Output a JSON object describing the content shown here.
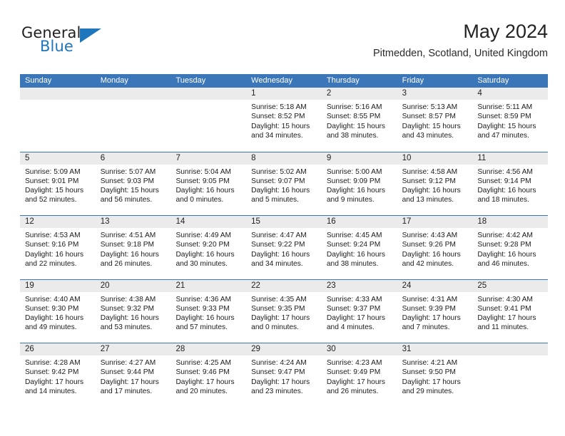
{
  "brand": {
    "name_top": "General",
    "name_bottom": "Blue",
    "color_dark": "#231f20",
    "color_blue": "#1f76bc"
  },
  "header": {
    "title": "May 2024",
    "subtitle": "Pitmedden, Scotland, United Kingdom"
  },
  "theme": {
    "header_blue": "#3a76b8",
    "day_band_gray": "#ebebeb",
    "text": "#1b1b1b"
  },
  "weekdays": [
    "Sunday",
    "Monday",
    "Tuesday",
    "Wednesday",
    "Thursday",
    "Friday",
    "Saturday"
  ],
  "weeks": [
    [
      {
        "day": "",
        "sunrise": "",
        "sunset": "",
        "daylight1": "",
        "daylight2": ""
      },
      {
        "day": "",
        "sunrise": "",
        "sunset": "",
        "daylight1": "",
        "daylight2": ""
      },
      {
        "day": "",
        "sunrise": "",
        "sunset": "",
        "daylight1": "",
        "daylight2": ""
      },
      {
        "day": "1",
        "sunrise": "Sunrise: 5:18 AM",
        "sunset": "Sunset: 8:52 PM",
        "daylight1": "Daylight: 15 hours",
        "daylight2": "and 34 minutes."
      },
      {
        "day": "2",
        "sunrise": "Sunrise: 5:16 AM",
        "sunset": "Sunset: 8:55 PM",
        "daylight1": "Daylight: 15 hours",
        "daylight2": "and 38 minutes."
      },
      {
        "day": "3",
        "sunrise": "Sunrise: 5:13 AM",
        "sunset": "Sunset: 8:57 PM",
        "daylight1": "Daylight: 15 hours",
        "daylight2": "and 43 minutes."
      },
      {
        "day": "4",
        "sunrise": "Sunrise: 5:11 AM",
        "sunset": "Sunset: 8:59 PM",
        "daylight1": "Daylight: 15 hours",
        "daylight2": "and 47 minutes."
      }
    ],
    [
      {
        "day": "5",
        "sunrise": "Sunrise: 5:09 AM",
        "sunset": "Sunset: 9:01 PM",
        "daylight1": "Daylight: 15 hours",
        "daylight2": "and 52 minutes."
      },
      {
        "day": "6",
        "sunrise": "Sunrise: 5:07 AM",
        "sunset": "Sunset: 9:03 PM",
        "daylight1": "Daylight: 15 hours",
        "daylight2": "and 56 minutes."
      },
      {
        "day": "7",
        "sunrise": "Sunrise: 5:04 AM",
        "sunset": "Sunset: 9:05 PM",
        "daylight1": "Daylight: 16 hours",
        "daylight2": "and 0 minutes."
      },
      {
        "day": "8",
        "sunrise": "Sunrise: 5:02 AM",
        "sunset": "Sunset: 9:07 PM",
        "daylight1": "Daylight: 16 hours",
        "daylight2": "and 5 minutes."
      },
      {
        "day": "9",
        "sunrise": "Sunrise: 5:00 AM",
        "sunset": "Sunset: 9:09 PM",
        "daylight1": "Daylight: 16 hours",
        "daylight2": "and 9 minutes."
      },
      {
        "day": "10",
        "sunrise": "Sunrise: 4:58 AM",
        "sunset": "Sunset: 9:12 PM",
        "daylight1": "Daylight: 16 hours",
        "daylight2": "and 13 minutes."
      },
      {
        "day": "11",
        "sunrise": "Sunrise: 4:56 AM",
        "sunset": "Sunset: 9:14 PM",
        "daylight1": "Daylight: 16 hours",
        "daylight2": "and 18 minutes."
      }
    ],
    [
      {
        "day": "12",
        "sunrise": "Sunrise: 4:53 AM",
        "sunset": "Sunset: 9:16 PM",
        "daylight1": "Daylight: 16 hours",
        "daylight2": "and 22 minutes."
      },
      {
        "day": "13",
        "sunrise": "Sunrise: 4:51 AM",
        "sunset": "Sunset: 9:18 PM",
        "daylight1": "Daylight: 16 hours",
        "daylight2": "and 26 minutes."
      },
      {
        "day": "14",
        "sunrise": "Sunrise: 4:49 AM",
        "sunset": "Sunset: 9:20 PM",
        "daylight1": "Daylight: 16 hours",
        "daylight2": "and 30 minutes."
      },
      {
        "day": "15",
        "sunrise": "Sunrise: 4:47 AM",
        "sunset": "Sunset: 9:22 PM",
        "daylight1": "Daylight: 16 hours",
        "daylight2": "and 34 minutes."
      },
      {
        "day": "16",
        "sunrise": "Sunrise: 4:45 AM",
        "sunset": "Sunset: 9:24 PM",
        "daylight1": "Daylight: 16 hours",
        "daylight2": "and 38 minutes."
      },
      {
        "day": "17",
        "sunrise": "Sunrise: 4:43 AM",
        "sunset": "Sunset: 9:26 PM",
        "daylight1": "Daylight: 16 hours",
        "daylight2": "and 42 minutes."
      },
      {
        "day": "18",
        "sunrise": "Sunrise: 4:42 AM",
        "sunset": "Sunset: 9:28 PM",
        "daylight1": "Daylight: 16 hours",
        "daylight2": "and 46 minutes."
      }
    ],
    [
      {
        "day": "19",
        "sunrise": "Sunrise: 4:40 AM",
        "sunset": "Sunset: 9:30 PM",
        "daylight1": "Daylight: 16 hours",
        "daylight2": "and 49 minutes."
      },
      {
        "day": "20",
        "sunrise": "Sunrise: 4:38 AM",
        "sunset": "Sunset: 9:32 PM",
        "daylight1": "Daylight: 16 hours",
        "daylight2": "and 53 minutes."
      },
      {
        "day": "21",
        "sunrise": "Sunrise: 4:36 AM",
        "sunset": "Sunset: 9:33 PM",
        "daylight1": "Daylight: 16 hours",
        "daylight2": "and 57 minutes."
      },
      {
        "day": "22",
        "sunrise": "Sunrise: 4:35 AM",
        "sunset": "Sunset: 9:35 PM",
        "daylight1": "Daylight: 17 hours",
        "daylight2": "and 0 minutes."
      },
      {
        "day": "23",
        "sunrise": "Sunrise: 4:33 AM",
        "sunset": "Sunset: 9:37 PM",
        "daylight1": "Daylight: 17 hours",
        "daylight2": "and 4 minutes."
      },
      {
        "day": "24",
        "sunrise": "Sunrise: 4:31 AM",
        "sunset": "Sunset: 9:39 PM",
        "daylight1": "Daylight: 17 hours",
        "daylight2": "and 7 minutes."
      },
      {
        "day": "25",
        "sunrise": "Sunrise: 4:30 AM",
        "sunset": "Sunset: 9:41 PM",
        "daylight1": "Daylight: 17 hours",
        "daylight2": "and 11 minutes."
      }
    ],
    [
      {
        "day": "26",
        "sunrise": "Sunrise: 4:28 AM",
        "sunset": "Sunset: 9:42 PM",
        "daylight1": "Daylight: 17 hours",
        "daylight2": "and 14 minutes."
      },
      {
        "day": "27",
        "sunrise": "Sunrise: 4:27 AM",
        "sunset": "Sunset: 9:44 PM",
        "daylight1": "Daylight: 17 hours",
        "daylight2": "and 17 minutes."
      },
      {
        "day": "28",
        "sunrise": "Sunrise: 4:25 AM",
        "sunset": "Sunset: 9:46 PM",
        "daylight1": "Daylight: 17 hours",
        "daylight2": "and 20 minutes."
      },
      {
        "day": "29",
        "sunrise": "Sunrise: 4:24 AM",
        "sunset": "Sunset: 9:47 PM",
        "daylight1": "Daylight: 17 hours",
        "daylight2": "and 23 minutes."
      },
      {
        "day": "30",
        "sunrise": "Sunrise: 4:23 AM",
        "sunset": "Sunset: 9:49 PM",
        "daylight1": "Daylight: 17 hours",
        "daylight2": "and 26 minutes."
      },
      {
        "day": "31",
        "sunrise": "Sunrise: 4:21 AM",
        "sunset": "Sunset: 9:50 PM",
        "daylight1": "Daylight: 17 hours",
        "daylight2": "and 29 minutes."
      },
      {
        "day": "",
        "sunrise": "",
        "sunset": "",
        "daylight1": "",
        "daylight2": ""
      }
    ]
  ]
}
